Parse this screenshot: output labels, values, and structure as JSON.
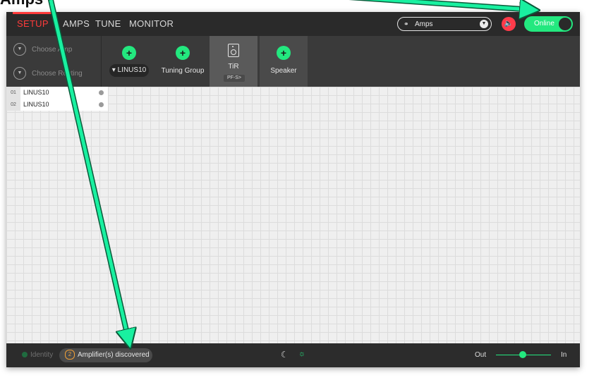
{
  "caption": "Amps",
  "nav": {
    "tabs": [
      {
        "label": "SETUP",
        "active": true
      },
      {
        "label": "AMPS",
        "active": false
      },
      {
        "label": "TUNE",
        "active": false
      },
      {
        "label": "MONITOR",
        "active": false
      }
    ],
    "amps_select": "Amps",
    "online_label": "Online"
  },
  "toolbar": {
    "choose_amp": "Choose Amp",
    "choose_routing": "Choose Routing",
    "linus_label": "LINUS10",
    "tuning_group": "Tuning Group",
    "tir_label": "TiR",
    "tir_sub": "PF-S>",
    "speaker": "Speaker"
  },
  "amplifiers": [
    {
      "num": "01",
      "name": "LINUS10"
    },
    {
      "num": "02",
      "name": "LINUS10"
    }
  ],
  "status": {
    "identity": "Identity",
    "discovered_count": "2",
    "discovered_label": "Amplifier(s) discovered",
    "out_label": "Out",
    "in_label": "In"
  },
  "sensitivity": 0.45,
  "colors": {
    "accent_green": "#23e87f",
    "accent_red": "#ff3b3b",
    "bar_dark": "#2a2a2a"
  },
  "icons": [
    "chevron-down-icon",
    "link-icon",
    "mute-icon",
    "plus-icon",
    "speaker-icon",
    "moon-icon",
    "sun-icon"
  ]
}
